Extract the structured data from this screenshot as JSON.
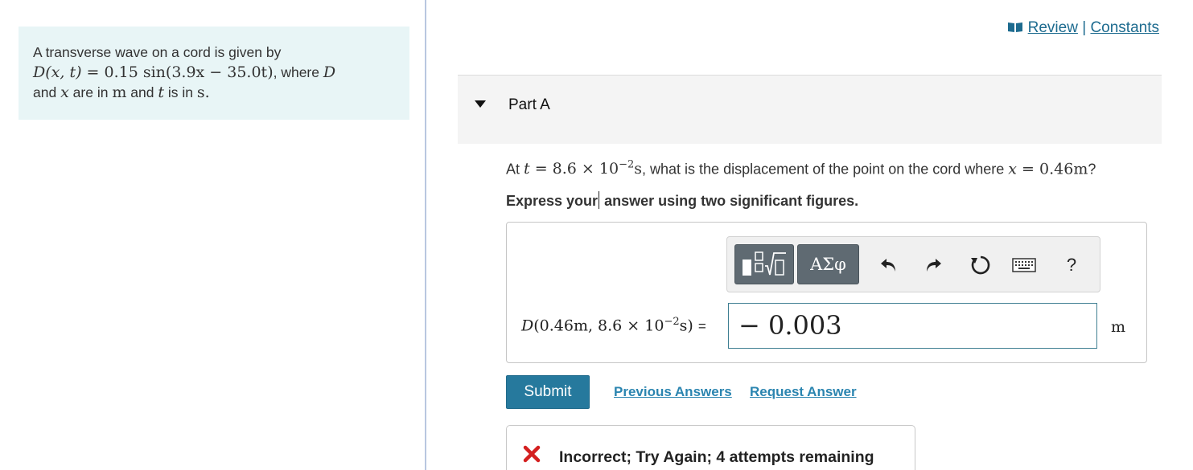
{
  "problem": {
    "intro": "A transverse wave on a cord is given by",
    "equation_lhs": "D(x, t)",
    "equation_rhs": "0.15 sin(3.9x − 35.0t)",
    "where_text": ", where",
    "var_D": "D",
    "line3_and": "and",
    "var_x": "x",
    "are_in": "are in",
    "unit_m": "m",
    "and_t": "and",
    "var_t": "t",
    "is_in": "is in",
    "unit_s": "s."
  },
  "top_links": {
    "review": "Review",
    "separator": "|",
    "constants": "Constants"
  },
  "part": {
    "title": "Part A"
  },
  "question": {
    "at": "At",
    "t_var": "t",
    "t_value": "8.6 × 10",
    "t_exp": "−2",
    "t_unit": "s",
    "mid_text": ", what is the displacement of the point on the cord where",
    "x_var": "x",
    "x_value": "0.46m",
    "end": "?"
  },
  "instruction": {
    "before_caret": "Express your",
    "after_caret": " answer using two significant figures."
  },
  "toolbar": {
    "symbols_label": "ΑΣφ",
    "help_label": "?"
  },
  "answer": {
    "label_D": "D",
    "label_args": "(0.46m, 8.6 × 10",
    "label_exp": "−2",
    "label_close": "s)",
    "label_eq": "=",
    "value": "− 0.003",
    "unit": "m"
  },
  "buttons": {
    "submit": "Submit",
    "previous_answers": "Previous Answers",
    "request_answer": "Request Answer"
  },
  "feedback": {
    "text": "Incorrect; Try Again; 4 attempts remaining",
    "color": "#d42020"
  },
  "colors": {
    "link": "#1d6b8f",
    "submit_bg": "#26799d",
    "problem_bg": "#e8f5f6"
  }
}
